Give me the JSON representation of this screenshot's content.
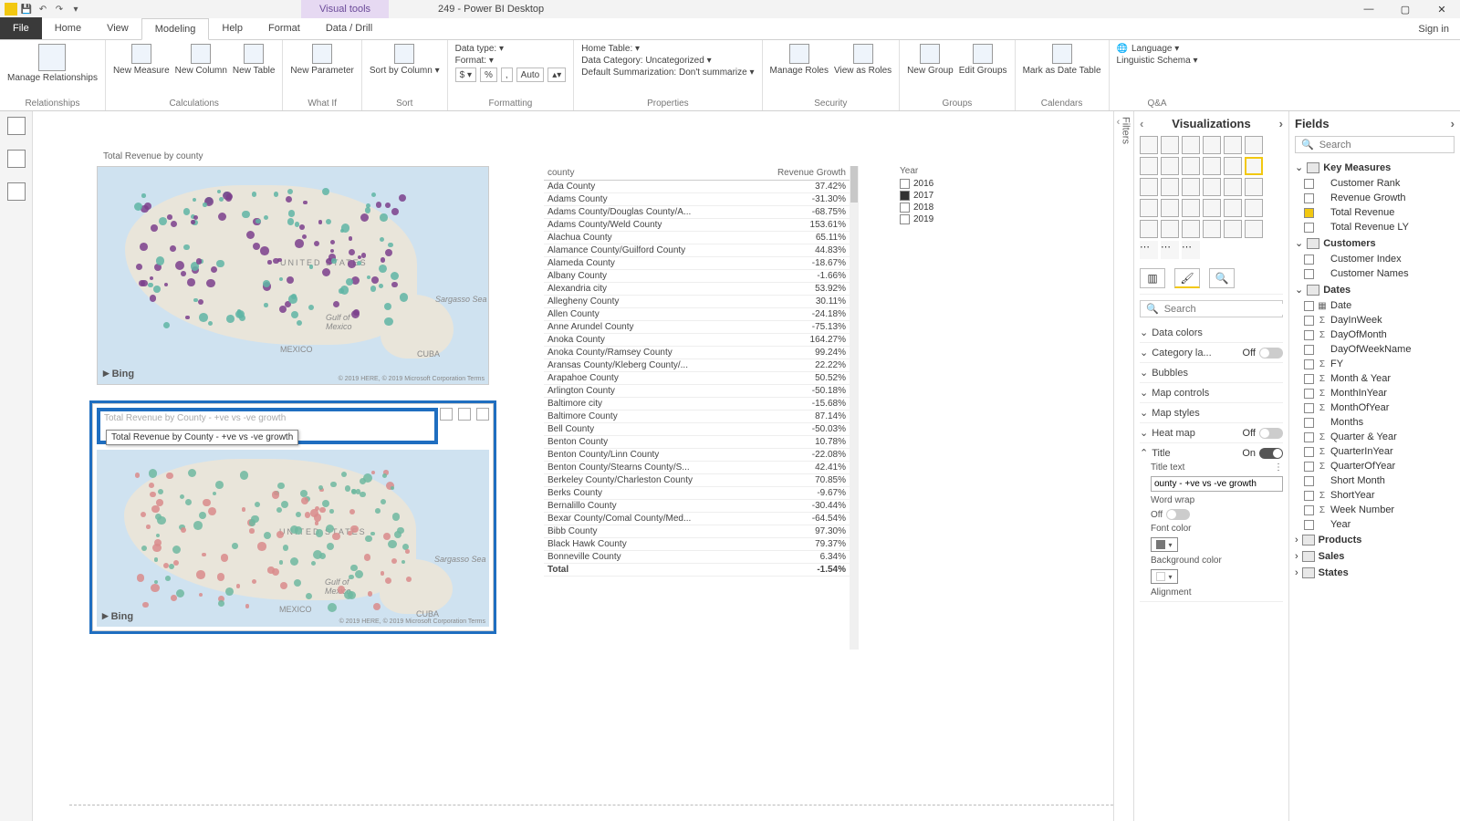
{
  "titlebar": {
    "visual_tools": "Visual tools",
    "title": "249 - Power BI Desktop",
    "signin": "Sign in"
  },
  "tabs": [
    "File",
    "Home",
    "View",
    "Modeling",
    "Help",
    "Format",
    "Data / Drill"
  ],
  "active_tab": "Modeling",
  "ribbon": {
    "groups": {
      "relationships": {
        "label": "Relationships",
        "items": [
          "Manage\nRelationships"
        ]
      },
      "calculations": {
        "label": "Calculations",
        "items": [
          "New\nMeasure",
          "New\nColumn",
          "New\nTable"
        ]
      },
      "whatif": {
        "label": "What If",
        "items": [
          "New\nParameter"
        ]
      },
      "sort": {
        "label": "Sort",
        "items": [
          "Sort by\nColumn ▾"
        ]
      },
      "formatting": {
        "label": "Formatting",
        "data_type": "Data type:  ▾",
        "format": "Format:  ▾",
        "currency": "$ ▾",
        "percent": "%",
        "comma": ",",
        "auto": "Auto",
        "stepper": "▴▾"
      },
      "properties": {
        "label": "Properties",
        "home_table": "Home Table:  ▾",
        "data_category": "Data Category: Uncategorized ▾",
        "default_sum": "Default Summarization: Don't summarize ▾"
      },
      "security": {
        "label": "Security",
        "items": [
          "Manage\nRoles",
          "View as\nRoles"
        ]
      },
      "groupsg": {
        "label": "Groups",
        "items": [
          "New\nGroup",
          "Edit\nGroups"
        ]
      },
      "calendars": {
        "label": "Calendars",
        "items": [
          "Mark as\nDate Table"
        ]
      },
      "qa": {
        "label": "Q&A",
        "language": "Language ▾",
        "schema": "Linguistic Schema ▾"
      }
    }
  },
  "filters_label": "Filters",
  "vis_panel": {
    "title": "Visualizations",
    "search_ph": "Search",
    "sections": {
      "data_colors": "Data colors",
      "category_labels": "Category la...",
      "bubbles": "Bubbles",
      "map_controls": "Map controls",
      "map_styles": "Map styles",
      "heat_map": "Heat map",
      "title": "Title",
      "title_text_label": "Title text",
      "title_text_value": "ounty - +ve vs -ve growth",
      "word_wrap": "Word wrap",
      "font_color": "Font color",
      "background_color": "Background color",
      "alignment": "Alignment",
      "on": "On",
      "off": "Off"
    }
  },
  "fields_panel": {
    "title": "Fields",
    "search_ph": "Search",
    "tables": [
      {
        "name": "Key Measures",
        "expanded": true,
        "fields": [
          {
            "name": "Customer Rank",
            "chk": false,
            "sig": ""
          },
          {
            "name": "Revenue Growth",
            "chk": false,
            "sig": ""
          },
          {
            "name": "Total Revenue",
            "chk": true,
            "sig": ""
          },
          {
            "name": "Total Revenue LY",
            "chk": false,
            "sig": ""
          }
        ]
      },
      {
        "name": "Customers",
        "expanded": true,
        "fields": [
          {
            "name": "Customer Index",
            "chk": false,
            "sig": ""
          },
          {
            "name": "Customer Names",
            "chk": false,
            "sig": ""
          }
        ]
      },
      {
        "name": "Dates",
        "expanded": true,
        "fields": [
          {
            "name": "Date",
            "chk": false,
            "sig": "▦"
          },
          {
            "name": "DayInWeek",
            "chk": false,
            "sig": "Σ"
          },
          {
            "name": "DayOfMonth",
            "chk": false,
            "sig": "Σ"
          },
          {
            "name": "DayOfWeekName",
            "chk": false,
            "sig": ""
          },
          {
            "name": "FY",
            "chk": false,
            "sig": "Σ"
          },
          {
            "name": "Month & Year",
            "chk": false,
            "sig": "Σ"
          },
          {
            "name": "MonthInYear",
            "chk": false,
            "sig": "Σ"
          },
          {
            "name": "MonthOfYear",
            "chk": false,
            "sig": "Σ"
          },
          {
            "name": "Months",
            "chk": false,
            "sig": ""
          },
          {
            "name": "Quarter & Year",
            "chk": false,
            "sig": "Σ"
          },
          {
            "name": "QuarterInYear",
            "chk": false,
            "sig": "Σ"
          },
          {
            "name": "QuarterOfYear",
            "chk": false,
            "sig": "Σ"
          },
          {
            "name": "Short Month",
            "chk": false,
            "sig": ""
          },
          {
            "name": "ShortYear",
            "chk": false,
            "sig": "Σ"
          },
          {
            "name": "Week Number",
            "chk": false,
            "sig": "Σ"
          },
          {
            "name": "Year",
            "chk": false,
            "sig": ""
          }
        ]
      },
      {
        "name": "Products",
        "expanded": false,
        "fields": []
      },
      {
        "name": "Sales",
        "expanded": false,
        "fields": []
      },
      {
        "name": "States",
        "expanded": false,
        "fields": []
      }
    ]
  },
  "canvas": {
    "map1_title": "Total Revenue by county",
    "map2_title": "Total Revenue by County - +ve vs -ve growth",
    "map2_tooltip": "Total Revenue by County - +ve vs -ve growth",
    "bing": "Bing",
    "credit": "© 2019 HERE, © 2019 Microsoft Corporation Terms",
    "labels": {
      "us": "UNITED STATES",
      "mexico": "MEXICO",
      "cuba": "CUBA",
      "gulf": "Gulf of\nMexico",
      "sargasso": "Sargasso Sea"
    },
    "table": {
      "headers": [
        "county",
        "Revenue Growth"
      ],
      "rows": [
        [
          "Ada County",
          "37.42%"
        ],
        [
          "Adams County",
          "-31.30%"
        ],
        [
          "Adams County/Douglas County/A...",
          "-68.75%"
        ],
        [
          "Adams County/Weld County",
          "153.61%"
        ],
        [
          "Alachua County",
          "65.11%"
        ],
        [
          "Alamance County/Guilford County",
          "44.83%"
        ],
        [
          "Alameda County",
          "-18.67%"
        ],
        [
          "Albany County",
          "-1.66%"
        ],
        [
          "Alexandria city",
          "53.92%"
        ],
        [
          "Allegheny County",
          "30.11%"
        ],
        [
          "Allen County",
          "-24.18%"
        ],
        [
          "Anne Arundel County",
          "-75.13%"
        ],
        [
          "Anoka County",
          "164.27%"
        ],
        [
          "Anoka County/Ramsey County",
          "99.24%"
        ],
        [
          "Aransas County/Kleberg County/...",
          "22.22%"
        ],
        [
          "Arapahoe County",
          "50.52%"
        ],
        [
          "Arlington County",
          "-50.18%"
        ],
        [
          "Baltimore city",
          "-15.68%"
        ],
        [
          "Baltimore County",
          "87.14%"
        ],
        [
          "Bell County",
          "-50.03%"
        ],
        [
          "Benton County",
          "10.78%"
        ],
        [
          "Benton County/Linn County",
          "-22.08%"
        ],
        [
          "Benton County/Stearns County/S...",
          "42.41%"
        ],
        [
          "Berkeley County/Charleston County",
          "70.85%"
        ],
        [
          "Berks County",
          "-9.67%"
        ],
        [
          "Bernalillo County",
          "-30.44%"
        ],
        [
          "Bexar County/Comal County/Med...",
          "-64.54%"
        ],
        [
          "Bibb County",
          "97.30%"
        ],
        [
          "Black Hawk County",
          "79.37%"
        ],
        [
          "Bonneville County",
          "6.34%"
        ]
      ],
      "total": [
        "Total",
        "-1.54%"
      ]
    },
    "slicer": {
      "title": "Year",
      "items": [
        {
          "label": "2016",
          "checked": false
        },
        {
          "label": "2017",
          "checked": true
        },
        {
          "label": "2018",
          "checked": false
        },
        {
          "label": "2019",
          "checked": false
        }
      ]
    }
  }
}
